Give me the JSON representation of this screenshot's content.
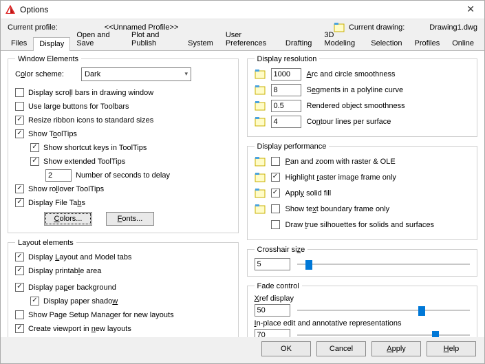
{
  "title": "Options",
  "current_profile_label": "Current profile:",
  "current_profile_value": "<<Unnamed Profile>>",
  "current_drawing_label": "Current drawing:",
  "current_drawing_value": "Drawing1.dwg",
  "tabs": [
    "Files",
    "Display",
    "Open and Save",
    "Plot and Publish",
    "System",
    "User Preferences",
    "Drafting",
    "3D Modeling",
    "Selection",
    "Profiles",
    "Online"
  ],
  "active_tab": "Display",
  "window_elements": {
    "legend": "Window Elements",
    "color_scheme_label": "Color scheme:",
    "color_scheme_value": "Dark",
    "scroll_bars": "Display scroll bars in drawing window",
    "large_buttons": "Use large buttons for Toolbars",
    "resize_ribbon": "Resize ribbon icons to standard sizes",
    "show_tooltips": "Show ToolTips",
    "show_shortcut": "Show shortcut keys in ToolTips",
    "show_extended": "Show extended ToolTips",
    "delay_value": "2",
    "delay_label": "Number of seconds to delay",
    "rollover": "Show rollover ToolTips",
    "file_tabs": "Display File Tabs",
    "colors_btn": "Colors...",
    "fonts_btn": "Fonts..."
  },
  "layout_elements": {
    "legend": "Layout elements",
    "layout_tabs": "Display Layout and Model tabs",
    "printable_area": "Display printable area",
    "paper_bg": "Display paper background",
    "paper_shadow": "Display paper shadow",
    "page_setup": "Show Page Setup Manager for new layouts",
    "create_viewport": "Create viewport in new layouts"
  },
  "display_resolution": {
    "legend": "Display resolution",
    "arc_val": "1000",
    "arc_lbl": "Arc and circle smoothness",
    "seg_val": "8",
    "seg_lbl": "Segments in a polyline curve",
    "ren_val": "0.5",
    "ren_lbl": "Rendered object smoothness",
    "con_val": "4",
    "con_lbl": "Contour lines per surface"
  },
  "display_performance": {
    "legend": "Display performance",
    "pan_zoom": "Pan and zoom with raster & OLE",
    "highlight": "Highlight raster image frame only",
    "solid_fill": "Apply solid fill",
    "text_boundary": "Show text boundary frame only",
    "true_sil": "Draw true silhouettes for solids and surfaces"
  },
  "crosshair": {
    "legend": "Crosshair size",
    "value": "5",
    "percent": 5
  },
  "fade": {
    "legend": "Fade control",
    "xref_label": "Xref display",
    "xref_value": "50",
    "xref_percent": 70,
    "inplace_label": "In-place edit and annotative representations",
    "inplace_value": "70",
    "inplace_percent": 78
  },
  "footer": {
    "ok": "OK",
    "cancel": "Cancel",
    "apply": "Apply",
    "help": "Help"
  }
}
